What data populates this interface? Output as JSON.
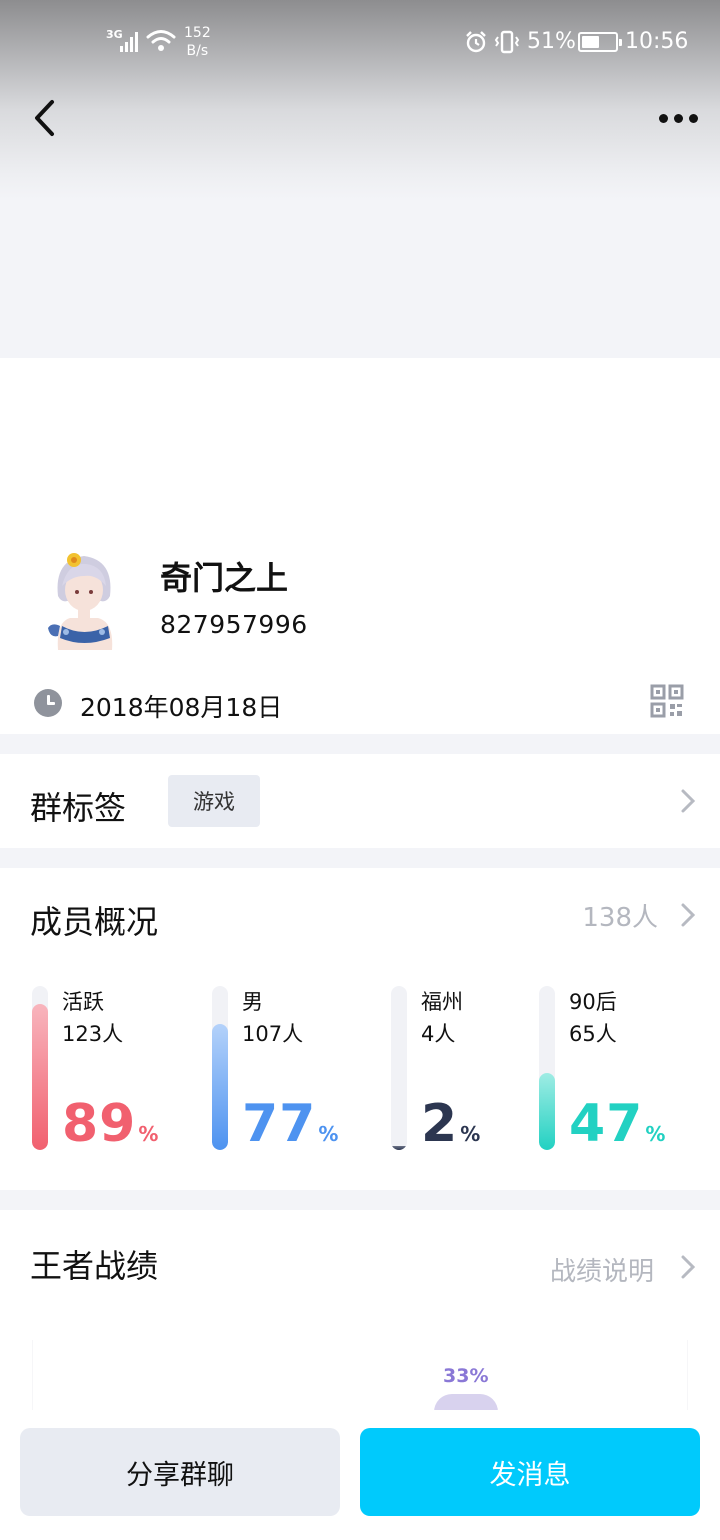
{
  "status_bar": {
    "network": "3G",
    "speed_value": "152",
    "speed_unit": "B/s",
    "battery_percent": "51%",
    "time": "10:56",
    "icons": [
      "signal-icon",
      "wifi-icon",
      "alarm-icon",
      "vibrate-icon",
      "battery-icon"
    ]
  },
  "nav": {
    "back_icon": "back-arrow-icon",
    "more_icon": "more-dots-icon"
  },
  "group": {
    "name": "奇门之上",
    "id": "827957996",
    "created_date": "2018年08月18日",
    "avatar_icon": "group-avatar"
  },
  "tags_row": {
    "title": "群标签",
    "tags": [
      "游戏"
    ]
  },
  "members": {
    "title": "成员概况",
    "count": "138人",
    "stats": [
      {
        "label": "活跃",
        "count": "123人",
        "value": "89",
        "unit": "%",
        "fraction": 0.89,
        "color": "#f1606f",
        "color_light": "#f8b5bd"
      },
      {
        "label": "男",
        "count": "107人",
        "value": "77",
        "unit": "%",
        "fraction": 0.77,
        "color": "#4e93f0",
        "color_light": "#b4d2fa"
      },
      {
        "label": "福州",
        "count": "4人",
        "value": "2",
        "unit": "%",
        "fraction": 0.02,
        "color": "#2c3650",
        "color_light": "#6d7488"
      },
      {
        "label": "90后",
        "count": "65人",
        "value": "47",
        "unit": "%",
        "fraction": 0.47,
        "color": "#22d1c2",
        "color_light": "#9fece4"
      }
    ]
  },
  "kings_record": {
    "title": "王者战绩",
    "link": "战绩说明",
    "chart_percent": "33%",
    "accent": "#8a78d6"
  },
  "actions": {
    "share": "分享群聊",
    "send": "发消息",
    "send_color": "#00cafc"
  }
}
